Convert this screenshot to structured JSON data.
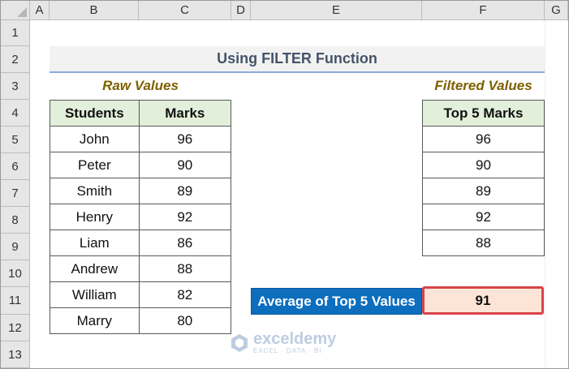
{
  "columns": [
    "A",
    "B",
    "C",
    "D",
    "E",
    "F",
    "G"
  ],
  "rows": [
    "1",
    "2",
    "3",
    "4",
    "5",
    "6",
    "7",
    "8",
    "9",
    "10",
    "11",
    "12",
    "13"
  ],
  "title": "Using FILTER Function",
  "raw_caption": "Raw Values",
  "filtered_caption": "Filtered Values",
  "raw_table": {
    "headers": [
      "Students",
      "Marks"
    ],
    "rows": [
      [
        "John",
        "96"
      ],
      [
        "Peter",
        "90"
      ],
      [
        "Smith",
        "89"
      ],
      [
        "Henry",
        "92"
      ],
      [
        "Liam",
        "86"
      ],
      [
        "Andrew",
        "88"
      ],
      [
        "William",
        "82"
      ],
      [
        "Marry",
        "80"
      ]
    ]
  },
  "filtered_table": {
    "header": "Top 5 Marks",
    "values": [
      "96",
      "90",
      "89",
      "92",
      "88"
    ]
  },
  "average": {
    "label": "Average of Top 5 Values",
    "value": "91"
  },
  "watermark": {
    "name": "exceldemy",
    "tagline": "EXCEL · DATA · BI"
  },
  "colors": {
    "header_fill": "#e2efda",
    "avg_label_fill": "#0d6ebe",
    "avg_value_fill": "#fce4d6",
    "highlight_border": "#d9434a",
    "caption_color": "#7f6000"
  }
}
